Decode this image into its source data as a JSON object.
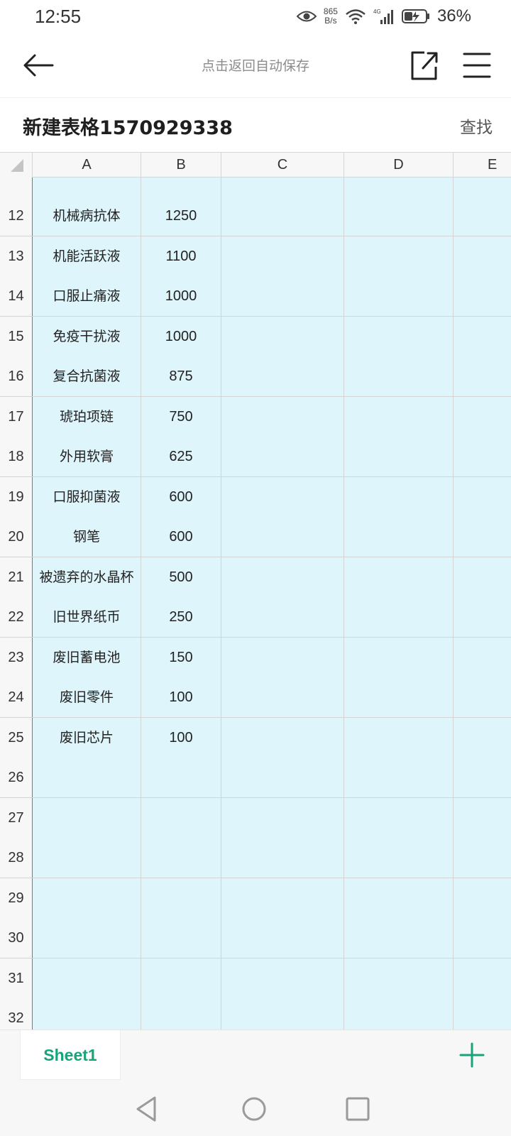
{
  "status_bar": {
    "time": "12:55",
    "net_speed_value": "865",
    "net_speed_unit": "B/s",
    "signal_label": "4G",
    "battery_percent": "36%"
  },
  "header": {
    "hint": "点击返回自动保存"
  },
  "title_row": {
    "title": "新建表格1570929338",
    "find_label": "查找"
  },
  "sheet": {
    "columns": [
      "A",
      "B",
      "C",
      "D",
      "E"
    ],
    "rows": [
      {
        "num": "12",
        "a": "机械病抗体",
        "b": "1250"
      },
      {
        "num": "13",
        "a": "机能活跃液",
        "b": "1100"
      },
      {
        "num": "14",
        "a": "口服止痛液",
        "b": "1000"
      },
      {
        "num": "15",
        "a": "免疫干扰液",
        "b": "1000"
      },
      {
        "num": "16",
        "a": "复合抗菌液",
        "b": "875"
      },
      {
        "num": "17",
        "a": "琥珀项链",
        "b": "750"
      },
      {
        "num": "18",
        "a": "外用软膏",
        "b": "625"
      },
      {
        "num": "19",
        "a": "口服抑菌液",
        "b": "600"
      },
      {
        "num": "20",
        "a": "钢笔",
        "b": "600"
      },
      {
        "num": "21",
        "a": "被遗弃的水晶杯",
        "b": "500"
      },
      {
        "num": "22",
        "a": "旧世界纸币",
        "b": "250"
      },
      {
        "num": "23",
        "a": "废旧蓄电池",
        "b": "150"
      },
      {
        "num": "24",
        "a": "废旧零件",
        "b": "100"
      },
      {
        "num": "25",
        "a": "废旧芯片",
        "b": "100"
      },
      {
        "num": "26",
        "a": "",
        "b": ""
      },
      {
        "num": "27",
        "a": "",
        "b": ""
      },
      {
        "num": "28",
        "a": "",
        "b": ""
      },
      {
        "num": "29",
        "a": "",
        "b": ""
      },
      {
        "num": "30",
        "a": "",
        "b": ""
      },
      {
        "num": "31",
        "a": "",
        "b": ""
      },
      {
        "num": "32",
        "a": "",
        "b": ""
      }
    ]
  },
  "tabs": {
    "sheets": [
      "Sheet1"
    ]
  },
  "colors": {
    "cell_fill": "#dff5fc",
    "accent_green": "#1aa37a",
    "frozen_line": "#4a7de0"
  }
}
